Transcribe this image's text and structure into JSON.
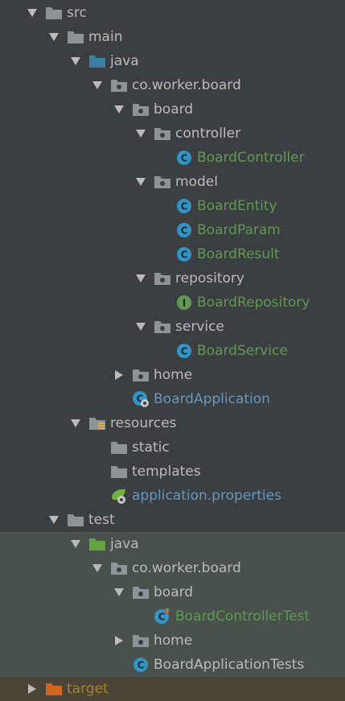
{
  "colors": {
    "background": "#3c3f41",
    "test_highlight": "#48514b",
    "target_highlight": "#4b4539",
    "folder_gray": "#8c9497",
    "java_source_folder": "#3c7e9f",
    "test_source_folder": "#62a240",
    "excluded_folder": "#d3641f",
    "class_icon": "#3592c4",
    "interface_icon": "#629755",
    "text_default": "#bbbbbb",
    "text_class": "#629755",
    "text_app": "#6897bb",
    "text_target": "#a4862a"
  },
  "tree": [
    {
      "label": "src",
      "arrow": "expanded",
      "icon": "folder-icon"
    },
    {
      "label": "main",
      "arrow": "expanded",
      "icon": "folder-icon"
    },
    {
      "label": "java",
      "arrow": "expanded",
      "icon": "source-root-folder-icon"
    },
    {
      "label": "co.worker.board",
      "arrow": "expanded",
      "icon": "package-icon"
    },
    {
      "label": "board",
      "arrow": "expanded",
      "icon": "package-icon"
    },
    {
      "label": "controller",
      "arrow": "expanded",
      "icon": "package-icon"
    },
    {
      "label": "BoardController",
      "arrow": "none",
      "icon": "class-icon"
    },
    {
      "label": "model",
      "arrow": "expanded",
      "icon": "package-icon"
    },
    {
      "label": "BoardEntity",
      "arrow": "none",
      "icon": "class-icon"
    },
    {
      "label": "BoardParam",
      "arrow": "none",
      "icon": "class-icon"
    },
    {
      "label": "BoardResult",
      "arrow": "none",
      "icon": "class-icon"
    },
    {
      "label": "repository",
      "arrow": "expanded",
      "icon": "package-icon"
    },
    {
      "label": "BoardRepository",
      "arrow": "none",
      "icon": "interface-icon"
    },
    {
      "label": "service",
      "arrow": "expanded",
      "icon": "package-icon"
    },
    {
      "label": "BoardService",
      "arrow": "none",
      "icon": "class-icon"
    },
    {
      "label": "home",
      "arrow": "collapsed",
      "icon": "package-icon"
    },
    {
      "label": "BoardApplication",
      "arrow": "none",
      "icon": "spring-boot-class-icon"
    },
    {
      "label": "resources",
      "arrow": "expanded",
      "icon": "resources-folder-icon"
    },
    {
      "label": "static",
      "arrow": "none",
      "icon": "folder-icon"
    },
    {
      "label": "templates",
      "arrow": "none",
      "icon": "folder-icon"
    },
    {
      "label": "application.properties",
      "arrow": "none",
      "icon": "spring-properties-icon"
    },
    {
      "label": "test",
      "arrow": "expanded",
      "icon": "folder-icon"
    },
    {
      "label": "java",
      "arrow": "expanded",
      "icon": "test-root-folder-icon"
    },
    {
      "label": "co.worker.board",
      "arrow": "expanded",
      "icon": "package-icon"
    },
    {
      "label": "board",
      "arrow": "expanded",
      "icon": "package-icon"
    },
    {
      "label": "BoardControllerTest",
      "arrow": "none",
      "icon": "test-class-icon"
    },
    {
      "label": "home",
      "arrow": "collapsed",
      "icon": "package-icon"
    },
    {
      "label": "BoardApplicationTests",
      "arrow": "none",
      "icon": "class-icon"
    },
    {
      "label": "target",
      "arrow": "collapsed",
      "icon": "excluded-folder-icon"
    }
  ]
}
